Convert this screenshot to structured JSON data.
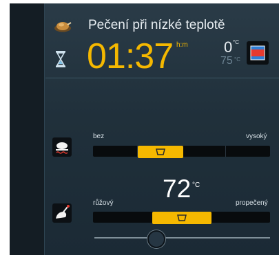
{
  "program": {
    "title": "Pečení při nízké teplotě",
    "icon": "roast-dish-icon"
  },
  "timer": {
    "icon": "hourglass-icon",
    "value": "01:37",
    "unit": "h:m"
  },
  "temperature": {
    "current": "0",
    "current_unit": "°C",
    "target": "75",
    "target_unit": "°C",
    "oven_button_icon": "oven-mode-icon"
  },
  "browning": {
    "icon": "browning-icon",
    "min_label": "bez",
    "max_label": "vysoký",
    "level_fraction": 0.38
  },
  "core_probe": {
    "icon": "core-probe-icon",
    "min_label": "růžový",
    "max_label": "propečený",
    "value": "72",
    "unit": "°C",
    "level_fraction": 0.5
  },
  "colors": {
    "accent": "#f5b800",
    "background": "#213240",
    "text": "#e8eef2"
  }
}
